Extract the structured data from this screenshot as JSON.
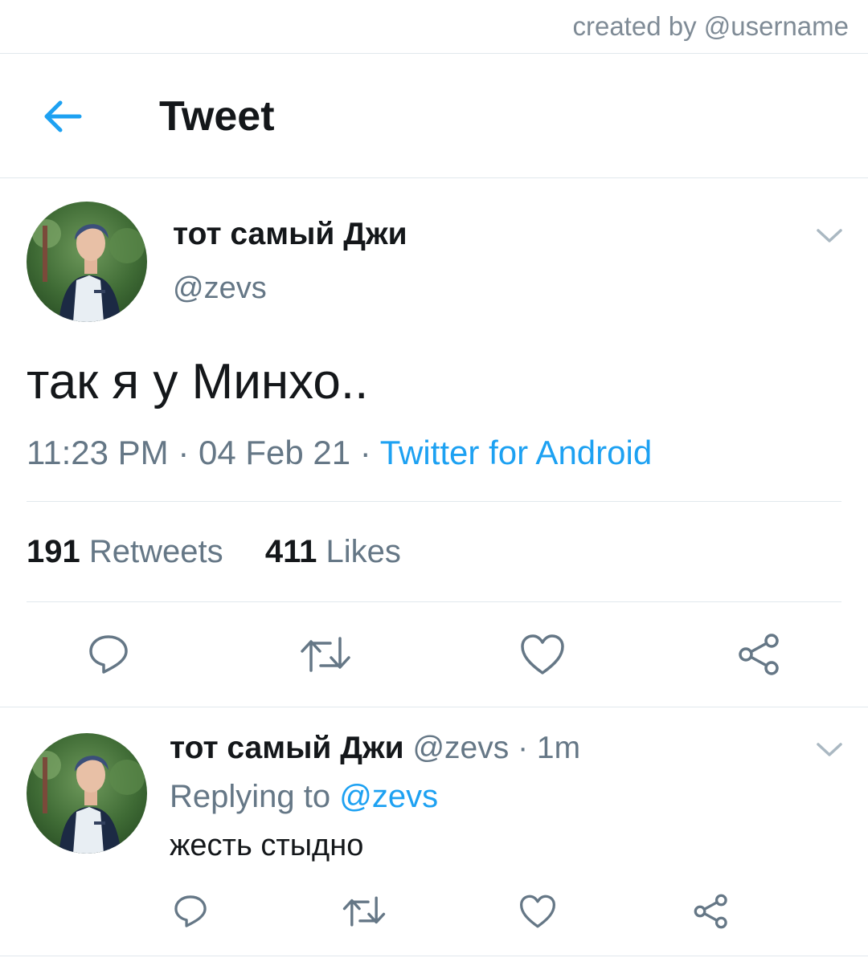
{
  "watermark": "created by @username",
  "header": {
    "title": "Tweet",
    "back_icon": "arrow-left-icon"
  },
  "colors": {
    "accent": "#1da1f2",
    "secondary_text": "#657786",
    "divider": "#e1e8ed"
  },
  "tweet": {
    "display_name": "тот самый Джи",
    "handle": "@zevs",
    "text": "так я у Минхо..",
    "time": "11:23 PM",
    "date": "04 Feb 21",
    "source": "Twitter for Android",
    "separator": " · ",
    "retweets": "191",
    "retweets_label": "Retweets",
    "likes": "411",
    "likes_label": "Likes",
    "actions": [
      "reply-icon",
      "retweet-icon",
      "like-icon",
      "share-icon"
    ]
  },
  "reply": {
    "display_name": "тот самый Джи",
    "handle": "@zevs",
    "time": "1m",
    "separator": " · ",
    "replying_prefix": "Replying to",
    "replying_to": "@zevs",
    "text": "жесть стыдно",
    "actions": [
      "reply-icon",
      "retweet-icon",
      "like-icon",
      "share-icon"
    ]
  }
}
